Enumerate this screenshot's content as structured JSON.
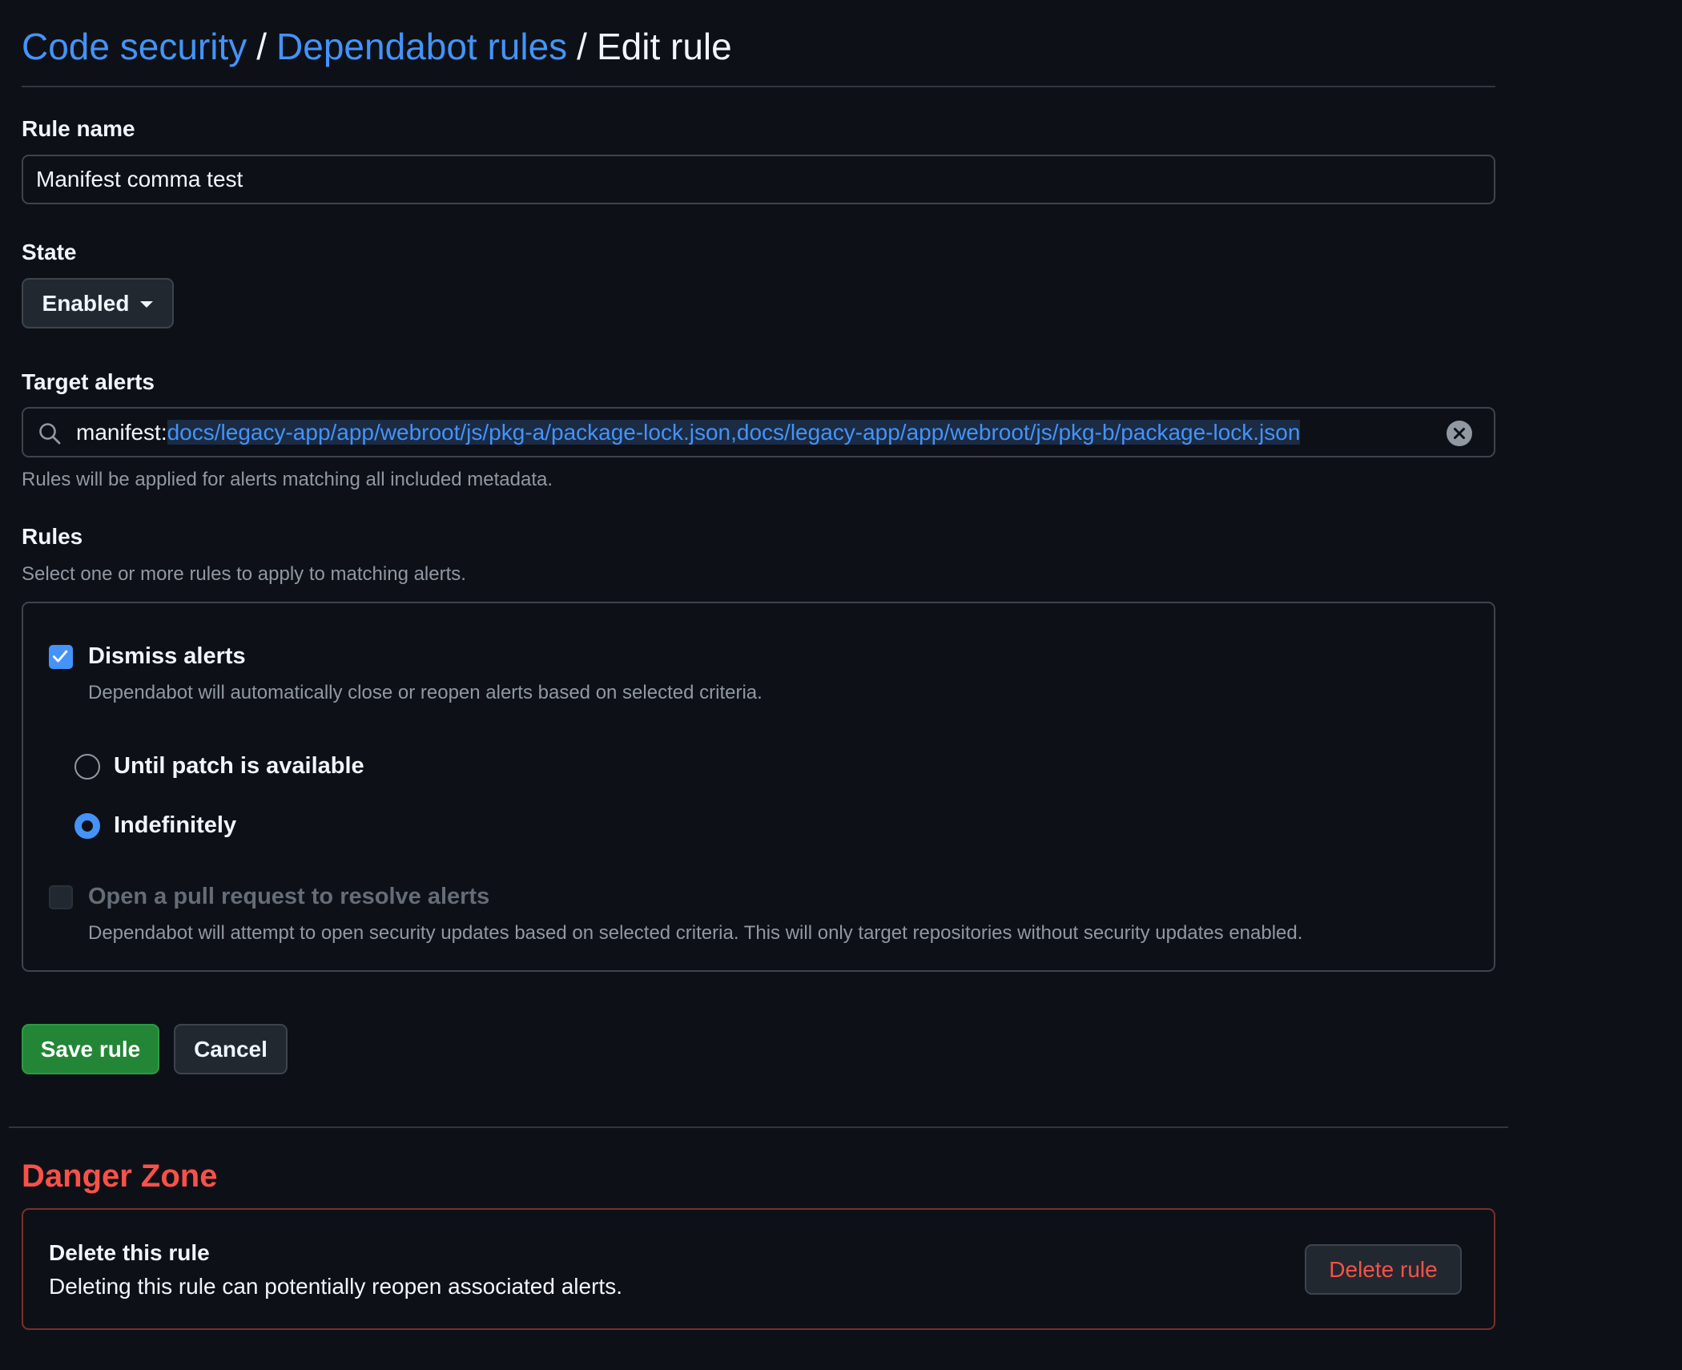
{
  "breadcrumb": {
    "items": [
      {
        "label": "Code security"
      },
      {
        "label": "Dependabot rules"
      }
    ],
    "separator": "/",
    "current": "Edit rule"
  },
  "rule_name": {
    "label": "Rule name",
    "value": "Manifest comma test"
  },
  "state": {
    "label": "State",
    "selected": "Enabled"
  },
  "target_alerts": {
    "label": "Target alerts",
    "qualifier": "manifest:",
    "value": "docs/legacy-app/app/webroot/js/pkg-a/package-lock.json,docs/legacy-app/app/webroot/js/pkg-b/package-lock.json",
    "hint": "Rules will be applied for alerts matching all included metadata."
  },
  "rules": {
    "label": "Rules",
    "hint": "Select one or more rules to apply to matching alerts.",
    "dismiss": {
      "label": "Dismiss alerts",
      "description": "Dependabot will automatically close or reopen alerts based on selected criteria.",
      "checked": true,
      "options": [
        {
          "label": "Until patch is available",
          "selected": false
        },
        {
          "label": "Indefinitely",
          "selected": true
        }
      ]
    },
    "pull_request": {
      "label": "Open a pull request to resolve alerts",
      "description": "Dependabot will attempt to open security updates based on selected criteria. This will only target repositories without security updates enabled.",
      "checked": false,
      "disabled": true
    }
  },
  "actions": {
    "save_label": "Save rule",
    "cancel_label": "Cancel"
  },
  "danger_zone": {
    "title": "Danger Zone",
    "heading": "Delete this rule",
    "description": "Deleting this rule can potentially reopen associated alerts.",
    "delete_label": "Delete rule"
  },
  "colors": {
    "background": "#0d1117",
    "link": "#4493f8",
    "accent_green": "#238636",
    "danger": "#f85149",
    "border": "#3d444d"
  },
  "icons": {
    "search": "search-icon",
    "clear": "x-circle-fill-icon",
    "caret": "triangle-down-icon",
    "check": "check-icon"
  }
}
